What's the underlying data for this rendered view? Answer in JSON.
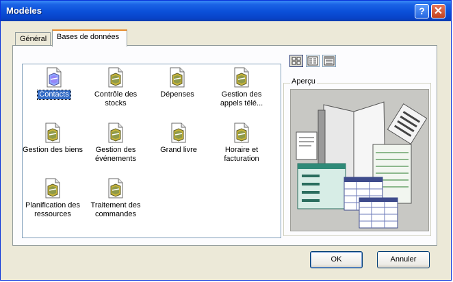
{
  "window": {
    "title": "Modèles",
    "help_label": "?",
    "close_label": "✕"
  },
  "tabs": [
    {
      "label": "Général",
      "selected": false
    },
    {
      "label": "Bases de données",
      "selected": true
    }
  ],
  "templates": [
    {
      "label": "Contacts",
      "selected": true
    },
    {
      "label": "Contrôle des stocks"
    },
    {
      "label": "Dépenses"
    },
    {
      "label": "Gestion des appels télé..."
    },
    {
      "label": "Gestion des biens"
    },
    {
      "label": "Gestion des événements"
    },
    {
      "label": "Grand livre"
    },
    {
      "label": "Horaire et facturation"
    },
    {
      "label": "Planification des ressources"
    },
    {
      "label": "Traitement des commandes"
    }
  ],
  "view_buttons": [
    {
      "icon": "large-icons-view-icon",
      "active": true
    },
    {
      "icon": "list-view-icon",
      "active": false
    },
    {
      "icon": "details-view-icon",
      "active": false
    }
  ],
  "preview": {
    "label": "Aperçu"
  },
  "buttons": {
    "ok": "OK",
    "cancel": "Annuler"
  },
  "colors": {
    "title_bar": "#0a4fd8",
    "selection": "#316ac5",
    "tab_highlight": "#e68b2c"
  }
}
